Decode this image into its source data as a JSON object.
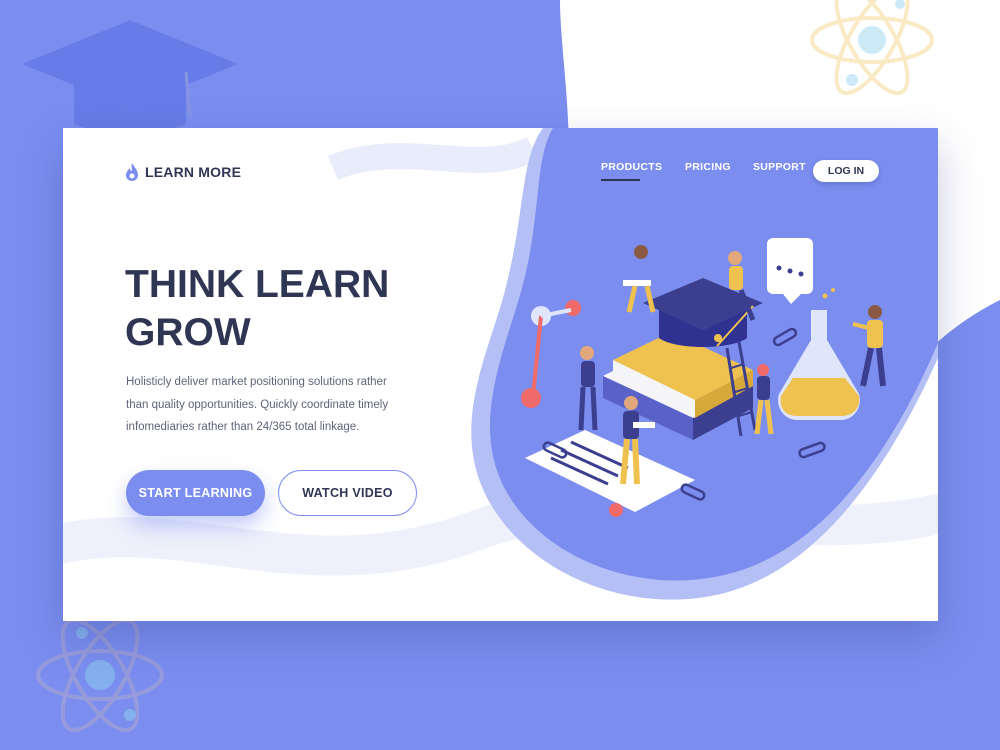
{
  "colors": {
    "accent": "#7b8ef0",
    "dark": "#2f3654",
    "background": "#7b8ef0",
    "panel": "#ffffff",
    "gold": "#efc24f",
    "coral": "#f06a6a"
  },
  "brand": {
    "name": "LEARN MORE",
    "icon": "flame-icon"
  },
  "nav": {
    "items": [
      {
        "label": "PRODUCTS",
        "active": true
      },
      {
        "label": "PRICING",
        "active": false
      },
      {
        "label": "SUPPORT",
        "active": false
      }
    ],
    "login_label": "LOG IN"
  },
  "hero": {
    "headline_line1": "THINK LEARN",
    "headline_line2": "GROW",
    "body_line1": "Holisticly deliver market positioning solutions rather",
    "body_line2": "than quality opportunities. Quickly coordinate timely",
    "body_line3": "infomediaries rather than 24/365 total linkage.",
    "start_label": "START LEARNING",
    "video_label": "WATCH VIDEO"
  },
  "decor": {
    "icons": [
      "graduation-cap-icon",
      "atom-icon",
      "chat-bubble-icon",
      "paperclip-icon",
      "flask-icon",
      "books-icon",
      "document-icon",
      "ladder-icon"
    ]
  }
}
